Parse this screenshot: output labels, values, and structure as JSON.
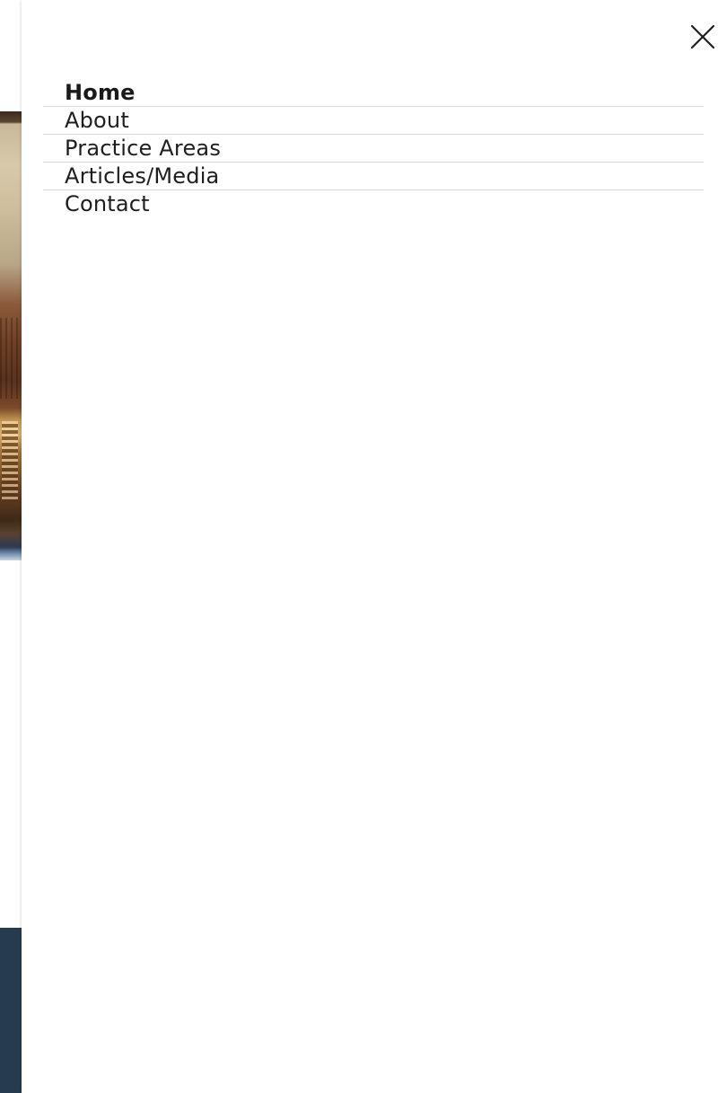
{
  "menu": {
    "items": [
      {
        "label": "Home",
        "active": true
      },
      {
        "label": "About",
        "active": false
      },
      {
        "label": "Practice Areas",
        "active": false
      },
      {
        "label": "Articles/Media",
        "active": false
      },
      {
        "label": "Contact",
        "active": false
      }
    ],
    "close_icon": "close-icon"
  },
  "colors": {
    "panel_background": "#ffffff",
    "text": "#1e1e1e",
    "divider": "#d6d6d6",
    "footer_background": "#263b4d"
  }
}
